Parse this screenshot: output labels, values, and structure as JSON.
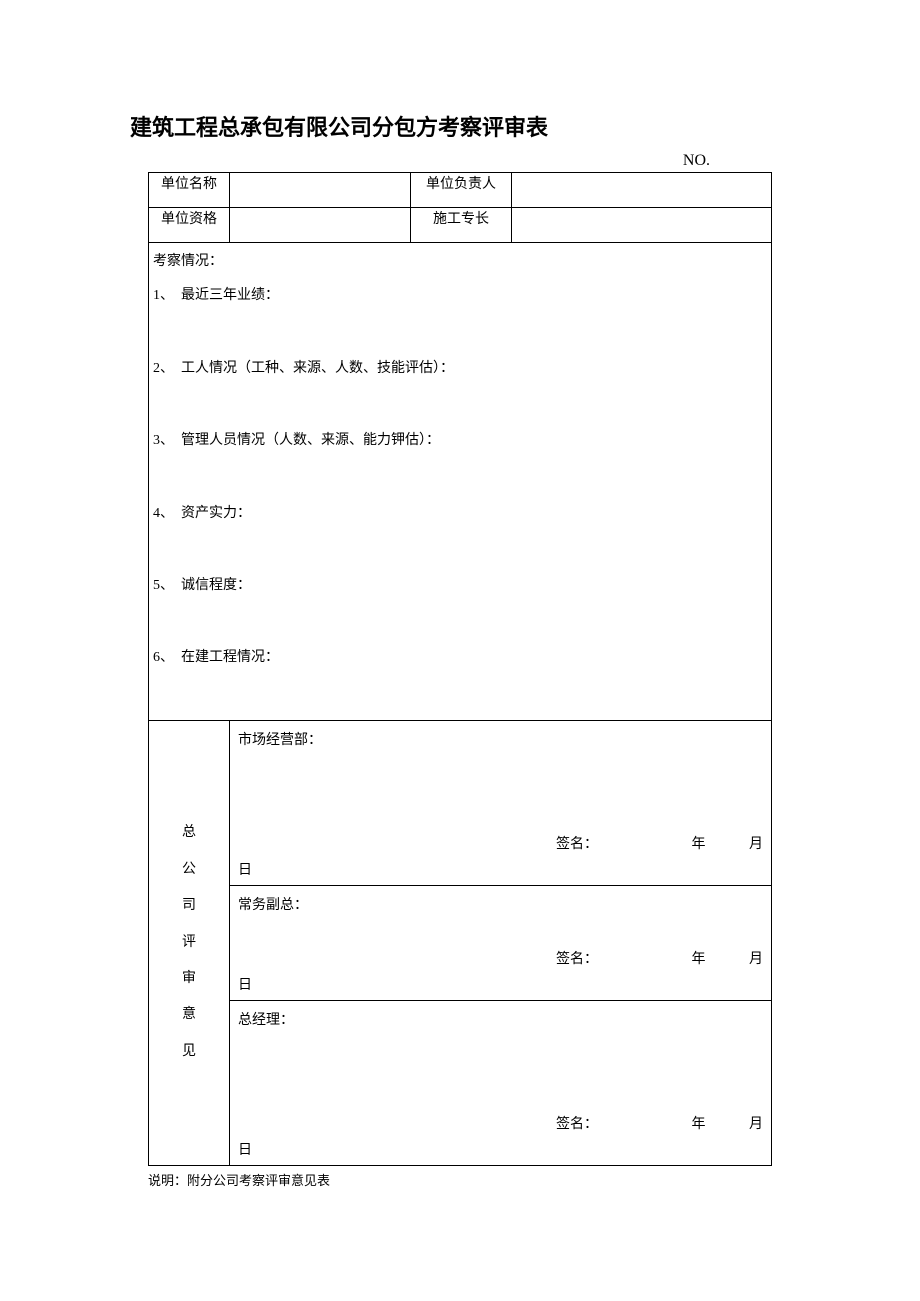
{
  "title": "建筑工程总承包有限公司分包方考察评审表",
  "no_label": "NO.",
  "head": {
    "unit_name_label": "单位名称",
    "unit_name_value": "",
    "unit_leader_label": "单位负责人",
    "unit_leader_value": "",
    "unit_qual_label": "单位资格",
    "unit_qual_value": "",
    "specialty_label": "施工专长",
    "specialty_value": ""
  },
  "inspection": {
    "header": "考察情况：",
    "items": [
      {
        "num": "1、",
        "text": "最近三年业绩："
      },
      {
        "num": "2、",
        "text": "工人情况（工种、来源、人数、技能评估）："
      },
      {
        "num": "3、",
        "text": "管理人员情况（人数、来源、能力钾估）："
      },
      {
        "num": "4、",
        "text": "资产实力："
      },
      {
        "num": "5、",
        "text": "诚信程度："
      },
      {
        "num": "6、",
        "text": "在建工程情况："
      }
    ]
  },
  "opinions": {
    "vlabel": "总 公 司 评 审 意 见",
    "blocks": [
      {
        "dept": "市场经营部：",
        "sign": "签名：",
        "year": "年",
        "month": "月",
        "day": "日"
      },
      {
        "dept": "常务副总：",
        "sign": "签名：",
        "year": "年",
        "month": "月",
        "day": "日"
      },
      {
        "dept": "总经理：",
        "sign": "签名：",
        "year": "年",
        "month": "月",
        "day": "日"
      }
    ]
  },
  "note": "说明：附分公司考察评审意见表"
}
